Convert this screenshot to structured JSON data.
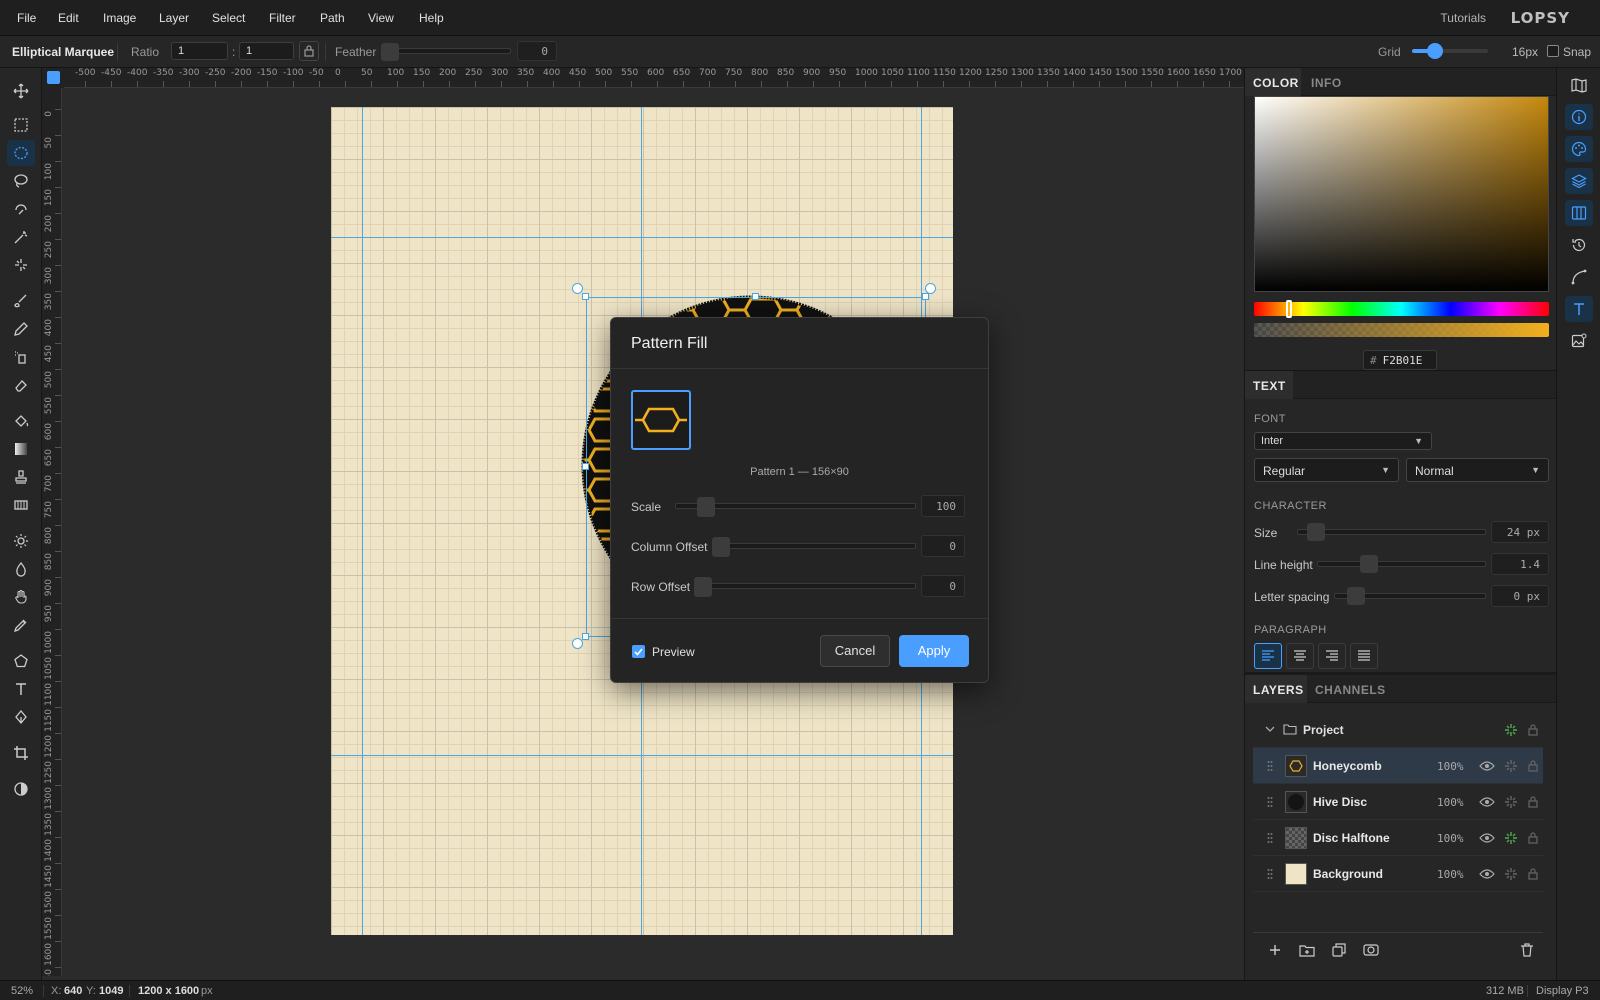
{
  "menu": {
    "items": [
      "File",
      "Edit",
      "Image",
      "Layer",
      "Select",
      "Filter",
      "Path",
      "View",
      "Help"
    ],
    "tutorials": "Tutorials",
    "logo": "LOPSY"
  },
  "options": {
    "tool_name": "Elliptical Marquee",
    "ratio_label": "Ratio",
    "ratio_w": "1",
    "ratio_sep": ":",
    "ratio_h": "1",
    "feather_label": "Feather",
    "feather_value": "0",
    "grid_label": "Grid",
    "grid_value": "16px",
    "grid_slider_fraction": 0.3,
    "snap_label": "Snap",
    "snap_checked": false
  },
  "rulers": {
    "top_ticks": [
      "-500",
      "-450",
      "-400",
      "-350",
      "-300",
      "-250",
      "-200",
      "-150",
      "-100",
      "-50",
      "0",
      "50",
      "100",
      "150",
      "200",
      "250",
      "300",
      "350",
      "400",
      "450",
      "500",
      "550",
      "600",
      "650",
      "700",
      "750",
      "800",
      "850",
      "900",
      "950",
      "1000",
      "1050",
      "1100",
      "1150",
      "1200",
      "1250",
      "1300",
      "1350",
      "1400",
      "1450",
      "1500",
      "1550",
      "1600",
      "1650",
      "1700"
    ],
    "left_ticks": [
      "0",
      "50",
      "100",
      "150",
      "200",
      "250",
      "300",
      "350",
      "400",
      "450",
      "500",
      "550",
      "600",
      "650",
      "700",
      "750",
      "800",
      "850",
      "900",
      "950",
      "1000",
      "1050",
      "1100",
      "1150",
      "1200",
      "1250",
      "1300",
      "1350",
      "1400",
      "1450",
      "1500",
      "1550",
      "1600",
      "1650"
    ]
  },
  "color_panel": {
    "tabs": [
      "COLOR",
      "INFO"
    ],
    "hex_prefix": "#",
    "hex": "F2B01E",
    "accent": "#F2B01E"
  },
  "text_panel": {
    "tab": "TEXT",
    "font_label": "FONT",
    "font": "Inter",
    "weight": "Regular",
    "style": "Normal",
    "character_label": "CHARACTER",
    "size_label": "Size",
    "size_value": "24 px",
    "line_height_label": "Line height",
    "line_height_value": "1.4",
    "letter_spacing_label": "Letter spacing",
    "letter_spacing_value": "0 px",
    "paragraph_label": "PARAGRAPH"
  },
  "layers_panel": {
    "tabs": [
      "LAYERS",
      "CHANNELS"
    ],
    "group": "Project",
    "layers": [
      {
        "name": "Honeycomb",
        "opacity": "100%",
        "selected": true
      },
      {
        "name": "Hive Disc",
        "opacity": "100%",
        "selected": false
      },
      {
        "name": "Disc Halftone",
        "opacity": "100%",
        "selected": false
      },
      {
        "name": "Background",
        "opacity": "100%",
        "selected": false
      }
    ]
  },
  "dialog": {
    "title": "Pattern Fill",
    "pattern_caption": "Pattern 1 — 156×90",
    "scale_label": "Scale",
    "scale_value": "100",
    "column_offset_label": "Column Offset",
    "column_offset_value": "0",
    "row_offset_label": "Row Offset",
    "row_offset_value": "0",
    "preview_label": "Preview",
    "preview_checked": true,
    "cancel_label": "Cancel",
    "apply_label": "Apply"
  },
  "status": {
    "zoom": "52%",
    "coords_x_label": "X:",
    "coords_x": "640",
    "coords_y_label": "Y:",
    "coords_y": "1049",
    "doc_size": "1200 x 1600",
    "doc_unit": "px",
    "memory": "312 MB",
    "profile": "Display P3"
  },
  "colors": {
    "accent_blue": "#4a9eff",
    "guide": "#4aa8e0",
    "paper": "#efe4c6",
    "honey": "#F2B01E"
  }
}
